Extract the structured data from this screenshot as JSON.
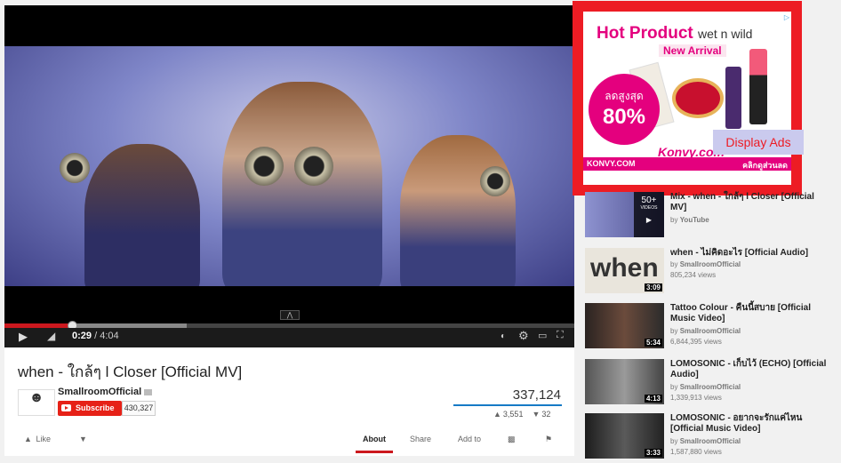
{
  "player": {
    "time_current": "0:29",
    "time_separator": "/",
    "time_total": "4:04",
    "progress_fraction": 0.119,
    "buffer_fraction": 0.32,
    "icons": [
      "play-icon",
      "volume-icon",
      "captions-icon",
      "settings-icon",
      "theater-icon",
      "fullscreen-icon",
      "expand-icon"
    ]
  },
  "video": {
    "title": "when - ใกล้ๆ l Closer [Official MV]",
    "channel": "SmallroomOfficial",
    "subscribe_label": "Subscribe",
    "subscriber_count": "430,327",
    "view_count": "337,124",
    "likes": "3,551",
    "dislikes": "32"
  },
  "actions": {
    "like_label": "Like",
    "about_tab": "About",
    "share_tab": "Share",
    "add_to_tab": "Add to"
  },
  "ad": {
    "headline": "Hot Product",
    "brand": "wet n wild",
    "subheadline": "New Arrival",
    "discount_label": "ลดสูงสุด",
    "discount_value": "80%",
    "site": "KONVY.COM",
    "logo": "Konvy.com",
    "cta": "คลิกดูส่วนลด",
    "annotation": "Display Ads",
    "accent_color": "#e4007e",
    "highlight_color": "#ed1c24"
  },
  "related": [
    {
      "title": "Mix - when - ใกล้ๆ l Closer [Official MV]",
      "by": "by",
      "channel": "YouTube",
      "views": "",
      "mix_count": "50+",
      "mix_label": "VIDEOS",
      "duration": ""
    },
    {
      "title": "when - ไม่คิดอะไร [Official Audio]",
      "by": "by",
      "channel": "SmallroomOfficial",
      "views": "805,234 views",
      "thumb_text": "when",
      "duration": "3:09"
    },
    {
      "title": "Tattoo Colour - คืนนี้สบาย [Official Music Video]",
      "by": "by",
      "channel": "SmallroomOfficial",
      "views": "6,844,395 views",
      "duration": "5:34"
    },
    {
      "title": "LOMOSONIC - เก็บไว้ (ECHO) [Official Audio]",
      "by": "by",
      "channel": "SmallroomOfficial",
      "views": "1,339,913 views",
      "duration": "4:13"
    },
    {
      "title": "LOMOSONIC - อยากจะรักแค่ไหน [Official Music Video]",
      "by": "by",
      "channel": "SmallroomOfficial",
      "views": "1,587,880 views",
      "duration": "3:33"
    }
  ]
}
